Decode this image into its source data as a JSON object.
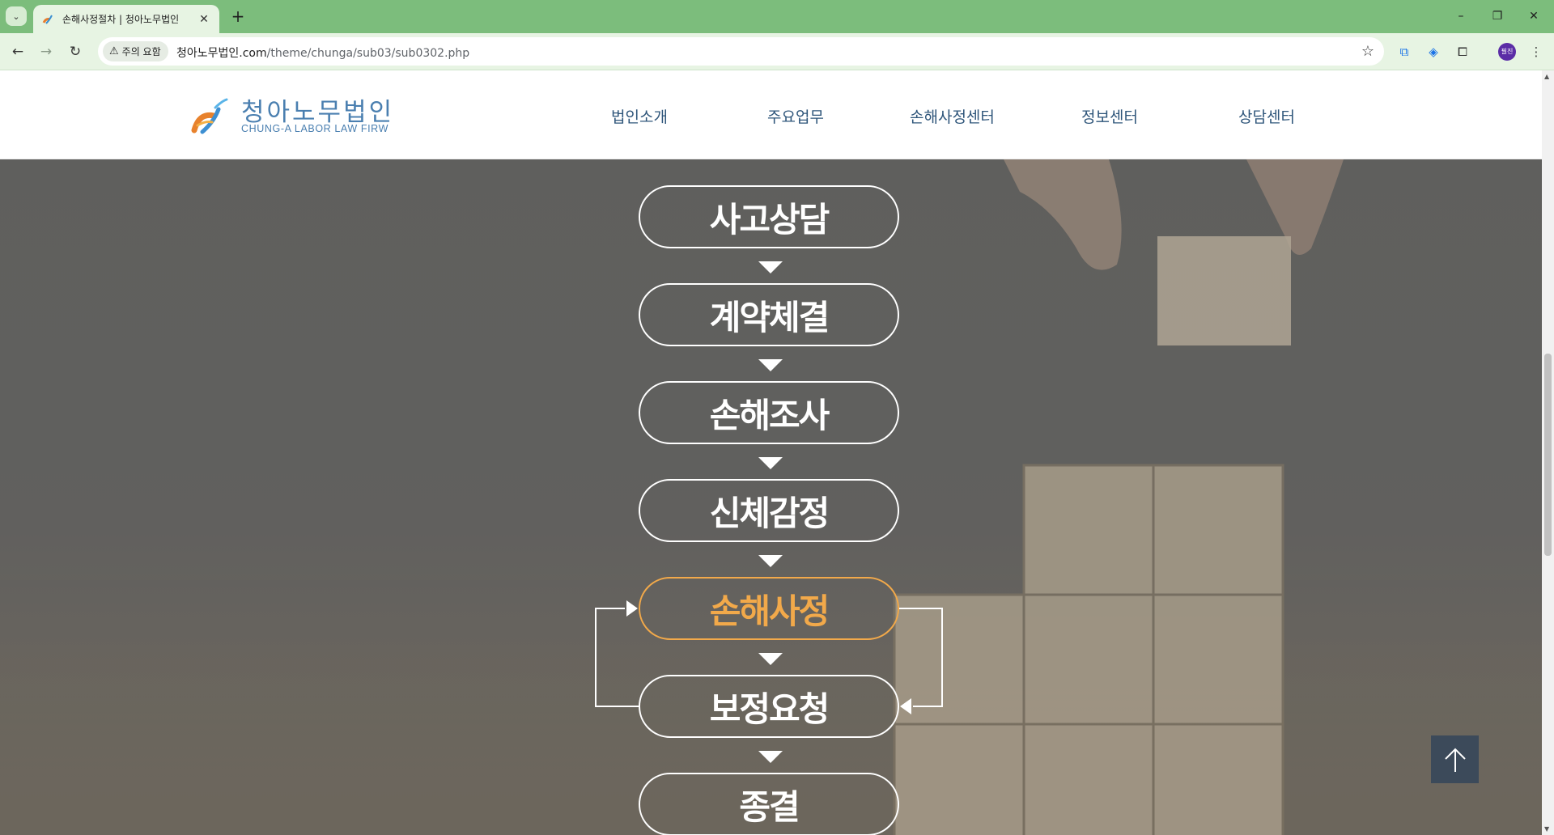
{
  "browser": {
    "tab_title": "손해사정절차 | 청아노무법인",
    "security_label": "주의 요함",
    "url_domain": "청아노무법인.com",
    "url_path": "/theme/chunga/sub03/sub0302.php",
    "profile_initials": "필진"
  },
  "site": {
    "logo_korean": "청아노무법인",
    "logo_english": "CHUNG-A LABOR LAW FIRW",
    "nav": [
      "법인소개",
      "주요업무",
      "손해사정센터",
      "정보센터",
      "상담센터"
    ]
  },
  "process": {
    "steps": [
      "사고상담",
      "계약체결",
      "손해조사",
      "신체감정",
      "손해사정",
      "보정요청",
      "종결"
    ],
    "active_step": "손해사정"
  },
  "colors": {
    "tab_bar": "#7cbd7c",
    "toolbar": "#e7f4e3",
    "nav_text": "#2e557a",
    "logo_blue": "#4a7fb0",
    "active_step": "#f2a94a",
    "top_button": "#3c4a5a"
  },
  "icons": {
    "back": "arrow-left-icon",
    "forward": "arrow-right-icon",
    "reload": "reload-icon",
    "bookmark": "star-icon",
    "scroll_top": "arrow-up-icon"
  }
}
